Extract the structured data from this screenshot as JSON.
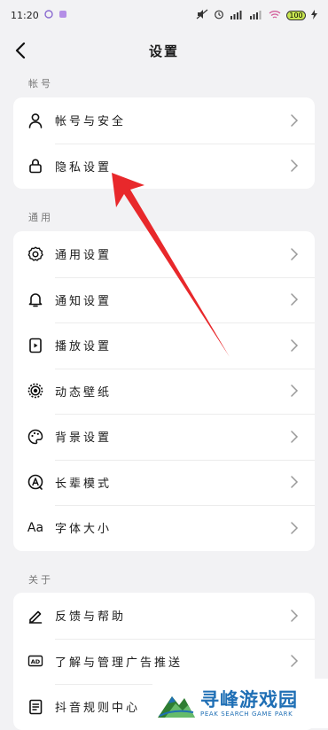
{
  "status_bar": {
    "time": "11:20",
    "battery": "100"
  },
  "header": {
    "title": "设置"
  },
  "sections": [
    {
      "title": "帐号",
      "items": [
        {
          "label": "帐号与安全",
          "icon": "person-icon"
        },
        {
          "label": "隐私设置",
          "icon": "lock-icon"
        }
      ]
    },
    {
      "title": "通用",
      "items": [
        {
          "label": "通用设置",
          "icon": "gear-icon"
        },
        {
          "label": "通知设置",
          "icon": "bell-icon"
        },
        {
          "label": "播放设置",
          "icon": "play-card-icon"
        },
        {
          "label": "动态壁纸",
          "icon": "live-wallpaper-icon"
        },
        {
          "label": "背景设置",
          "icon": "palette-icon"
        },
        {
          "label": "长辈模式",
          "icon": "elder-mode-icon"
        },
        {
          "label": "字体大小",
          "icon": "font-size-icon",
          "icon_text": "Aa"
        }
      ]
    },
    {
      "title": "关于",
      "items": [
        {
          "label": "反馈与帮助",
          "icon": "pen-icon"
        },
        {
          "label": "了解与管理广告推送",
          "icon": "ad-icon",
          "icon_text": "AD"
        },
        {
          "label": "抖音规则中心",
          "icon": "rules-icon"
        }
      ]
    }
  ],
  "watermark": {
    "name": "寻峰游戏园",
    "tagline": "PEAK SEARCH GAME PARK"
  },
  "colors": {
    "background": "#f2f2f4",
    "card": "#ffffff",
    "annotation_arrow": "#e8282b",
    "watermark_blue": "#1f6fb5"
  }
}
